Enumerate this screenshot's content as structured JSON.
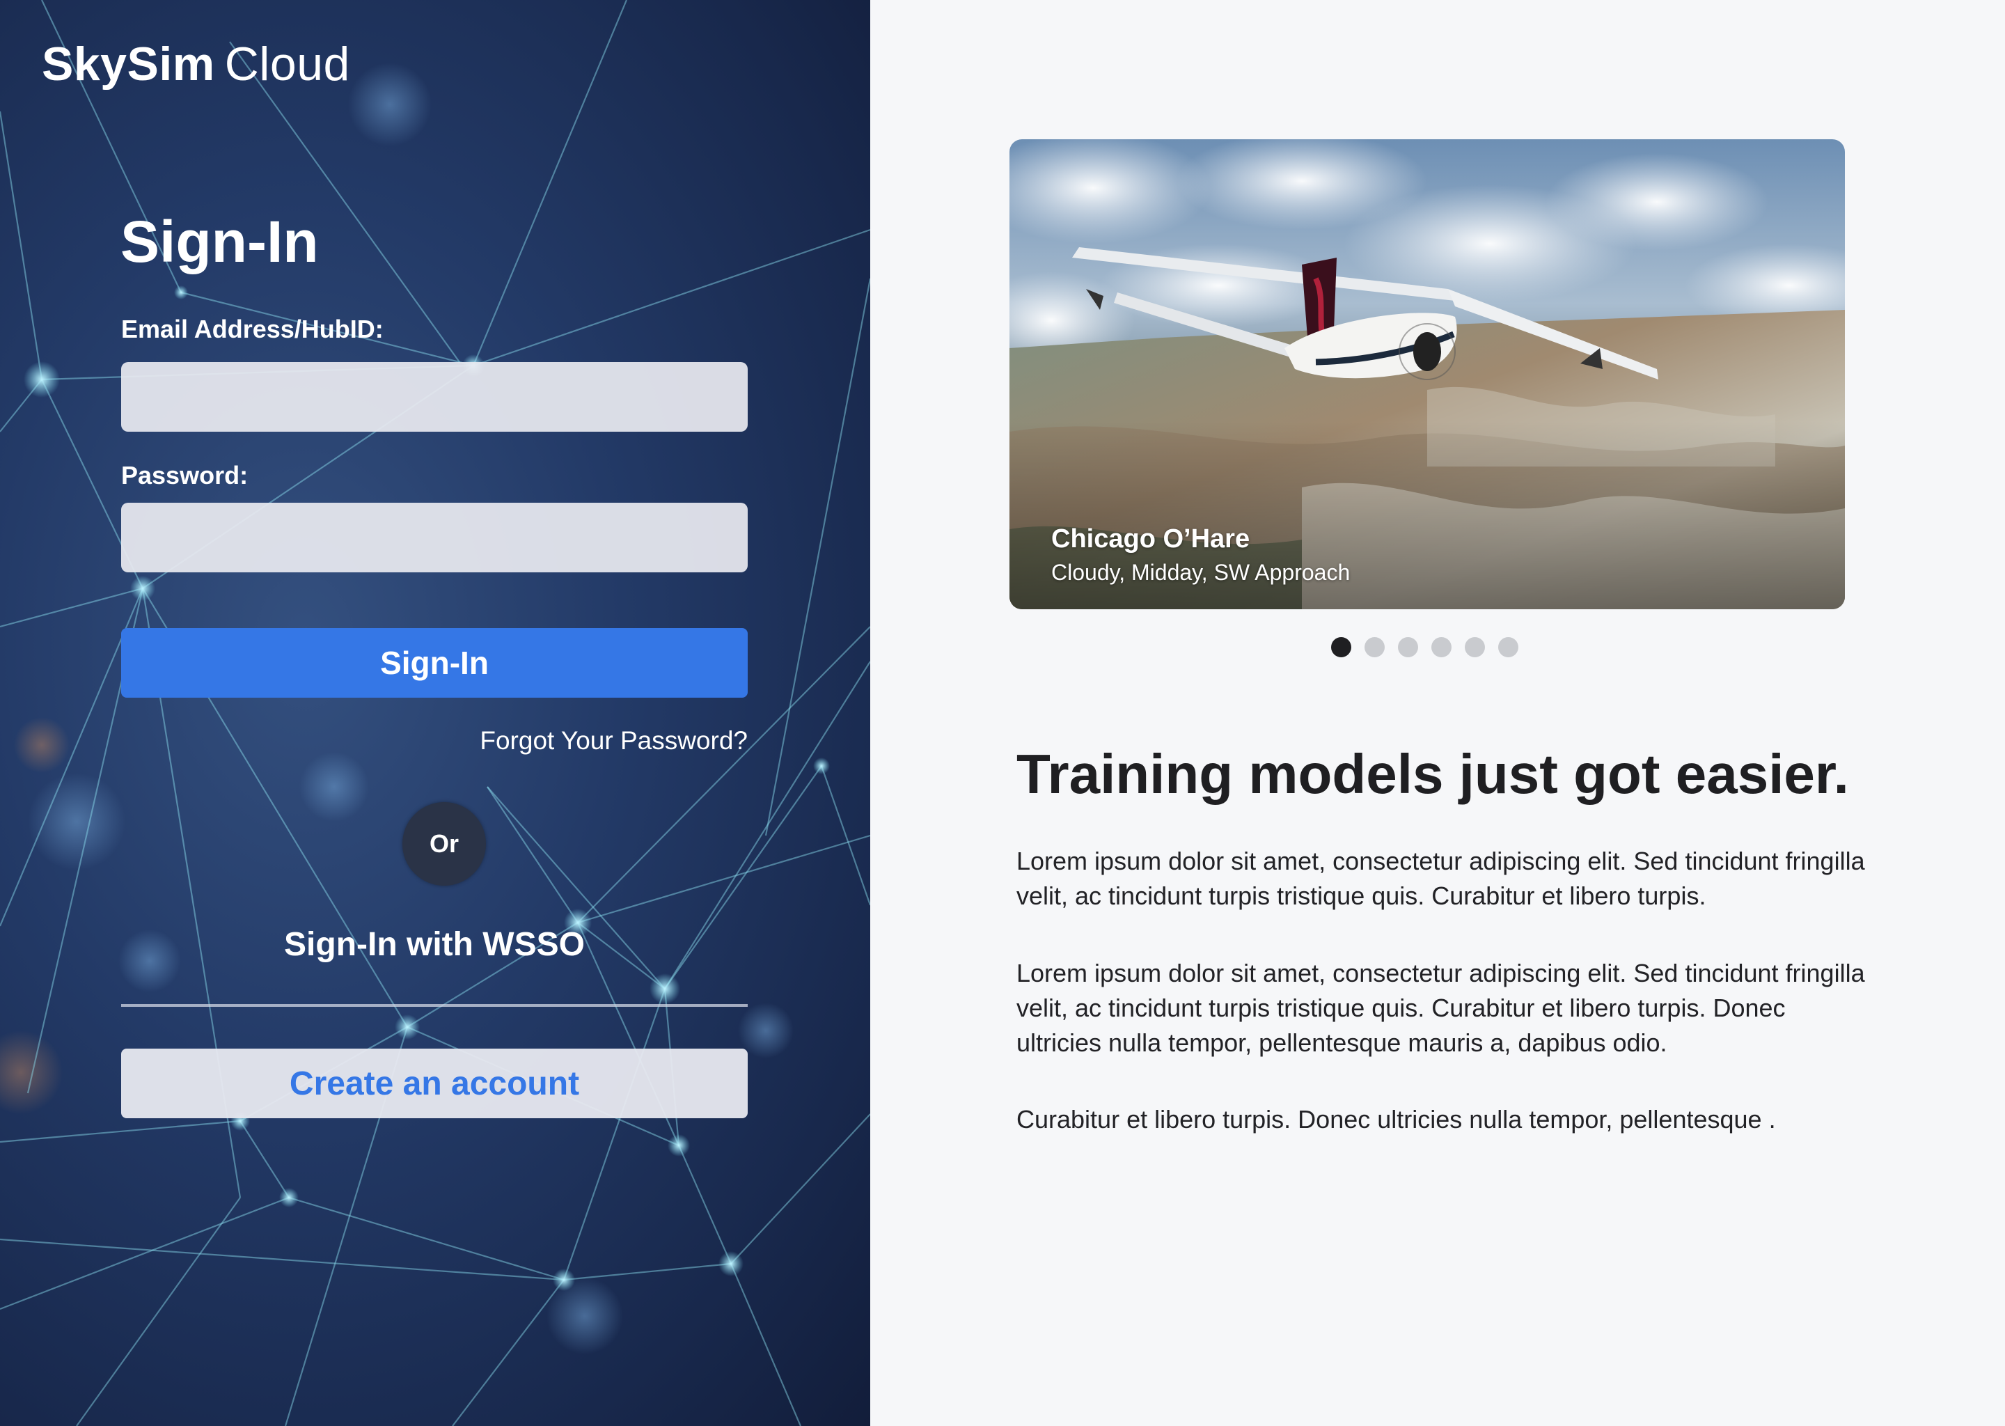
{
  "brand": {
    "name_bold": "SkySim",
    "name_regular": "Cloud"
  },
  "signin": {
    "title": "Sign-In",
    "email_label": "Email Address/HubID:",
    "email_value": "",
    "email_placeholder": "",
    "password_label": "Password:",
    "password_value": "",
    "password_placeholder": "",
    "submit_label": "Sign-In",
    "forgot_label": "Forgot Your Password?",
    "or_label": "Or",
    "wsso_label": "Sign-In with WSSO",
    "create_account_label": "Create an account"
  },
  "carousel": {
    "slide_title": "Chicago O’Hare",
    "slide_subtitle": "Cloudy, Midday, SW Approach",
    "dot_count": 6,
    "active_index": 0
  },
  "content": {
    "headline": "Training models just got easier.",
    "paragraphs": [
      "Lorem ipsum dolor sit amet, consectetur adipiscing elit. Sed tincidunt fringilla velit, ac tincidunt turpis tristique quis. Curabitur et libero turpis.",
      "Lorem ipsum dolor sit amet, consectetur adipiscing elit. Sed tincidunt fringilla velit, ac tincidunt turpis tristique quis. Curabitur et libero turpis. Donec ultricies nulla tempor, pellentesque mauris a, dapibus odio.",
      "Curabitur et libero turpis. Donec ultricies nulla tempor, pellentesque ."
    ]
  },
  "colors": {
    "accent_blue": "#3577e6",
    "left_panel_navy": "#233a67",
    "page_background": "#f6f7f9",
    "active_dot": "#1f1f22",
    "inactive_dot": "#c9cbcf"
  }
}
